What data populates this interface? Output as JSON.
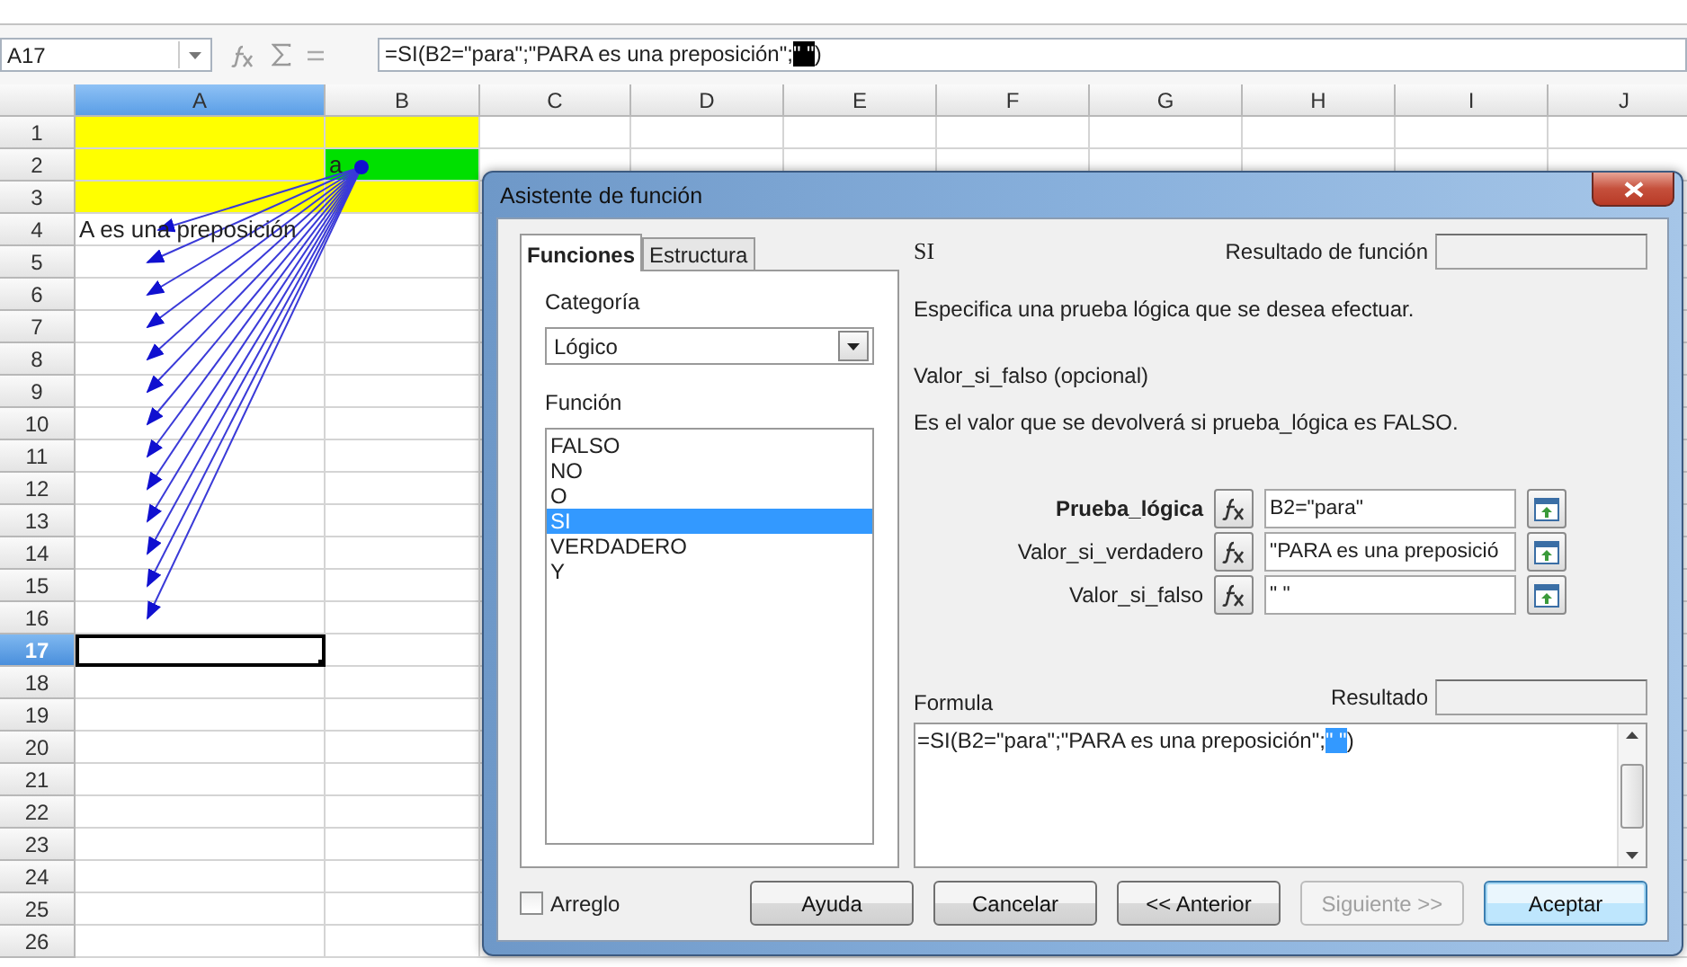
{
  "name_box": {
    "value": "A17"
  },
  "formula_bar": {
    "parts": [
      {
        "text": "=SI(B2=\"para\";\"PARA es una preposición\";",
        "selected": false
      },
      {
        "text": "\" \"",
        "selected": true
      },
      {
        "text": ")",
        "selected": false
      }
    ]
  },
  "columns": [
    {
      "label": "A",
      "selected": true
    },
    {
      "label": "B",
      "selected": false
    },
    {
      "label": "C",
      "selected": false
    },
    {
      "label": "D",
      "selected": false
    },
    {
      "label": "E",
      "selected": false
    },
    {
      "label": "F",
      "selected": false
    },
    {
      "label": "G",
      "selected": false
    },
    {
      "label": "H",
      "selected": false
    },
    {
      "label": "I",
      "selected": false
    },
    {
      "label": "J",
      "selected": false
    }
  ],
  "rows": [
    {
      "label": "1",
      "selected": false,
      "cells": [
        {
          "color": "#ffff00",
          "selected": false
        },
        {
          "color": "#ffff00",
          "selected": false
        }
      ]
    },
    {
      "label": "2",
      "selected": false,
      "cells": [
        {
          "color": "#ffff00",
          "selected": false
        },
        {
          "text": "a",
          "color": "#00e000",
          "selected": false
        }
      ]
    },
    {
      "label": "3",
      "selected": false,
      "cells": [
        {
          "color": "#ffff00",
          "selected": false
        },
        {
          "color": "#ffff00",
          "selected": false
        }
      ]
    },
    {
      "label": "4",
      "selected": false,
      "cells": [
        {
          "text": "A es una preposición",
          "selected": false
        }
      ]
    },
    {
      "label": "5",
      "selected": false
    },
    {
      "label": "6",
      "selected": false
    },
    {
      "label": "7",
      "selected": false
    },
    {
      "label": "8",
      "selected": false
    },
    {
      "label": "9",
      "selected": false
    },
    {
      "label": "10",
      "selected": false
    },
    {
      "label": "11",
      "selected": false
    },
    {
      "label": "12",
      "selected": false
    },
    {
      "label": "13",
      "selected": false
    },
    {
      "label": "14",
      "selected": false
    },
    {
      "label": "15",
      "selected": false
    },
    {
      "label": "16",
      "selected": false
    },
    {
      "label": "17",
      "selected": true,
      "cells": [
        {
          "selected": true
        }
      ]
    },
    {
      "label": "18",
      "selected": false
    },
    {
      "label": "19",
      "selected": false
    },
    {
      "label": "20",
      "selected": false
    },
    {
      "label": "21",
      "selected": false
    },
    {
      "label": "22",
      "selected": false
    },
    {
      "label": "23",
      "selected": false
    },
    {
      "label": "24",
      "selected": false
    },
    {
      "label": "25",
      "selected": false
    },
    {
      "label": "26",
      "selected": false
    }
  ],
  "dialog": {
    "title": "Asistente de función",
    "tabs": [
      {
        "label": "Funciones",
        "selected": true
      },
      {
        "label": "Estructura",
        "selected": false
      }
    ],
    "category": {
      "label": "Categoría",
      "value": "Lógico"
    },
    "function_label": "Función",
    "functions": [
      {
        "label": "FALSO",
        "selected": false
      },
      {
        "label": "NO",
        "selected": false
      },
      {
        "label": "O",
        "selected": false
      },
      {
        "label": "SI",
        "selected": true
      },
      {
        "label": "VERDADERO",
        "selected": false
      },
      {
        "label": "Y",
        "selected": false
      }
    ],
    "function_name": "SI",
    "result_label": "Resultado de función",
    "description": "Especifica una prueba lógica que se desea efectuar.",
    "argument_name": "Valor_si_falso (opcional)",
    "argument_description": "Es el valor que se devolverá si prueba_lógica es FALSO.",
    "arguments": [
      {
        "label": "Prueba_lógica",
        "value": "B2=\"para\"",
        "bold": true
      },
      {
        "label": "Valor_si_verdadero",
        "value": "\"PARA es una preposició",
        "bold": false
      },
      {
        "label": "Valor_si_falso",
        "value": "\" \"",
        "bold": false
      }
    ],
    "formula_label": "Formula",
    "formula_result_label": "Resultado",
    "formula": {
      "parts": [
        {
          "text": "=SI(B2=\"para\";\"PARA es una preposición\";",
          "selected": false
        },
        {
          "text": "\" \"",
          "selected": true
        },
        {
          "text": ")",
          "selected": false
        }
      ]
    },
    "array": {
      "label": "Arreglo",
      "checked": false
    },
    "buttons": [
      {
        "label": "Ayuda",
        "disabled": false,
        "default": false
      },
      {
        "label": "Cancelar",
        "disabled": false,
        "default": false
      },
      {
        "label": "<< Anterior",
        "disabled": false,
        "default": false
      },
      {
        "label": "Siguiente >>",
        "disabled": true,
        "default": false
      },
      {
        "label": "Aceptar",
        "disabled": false,
        "default": true
      }
    ]
  }
}
